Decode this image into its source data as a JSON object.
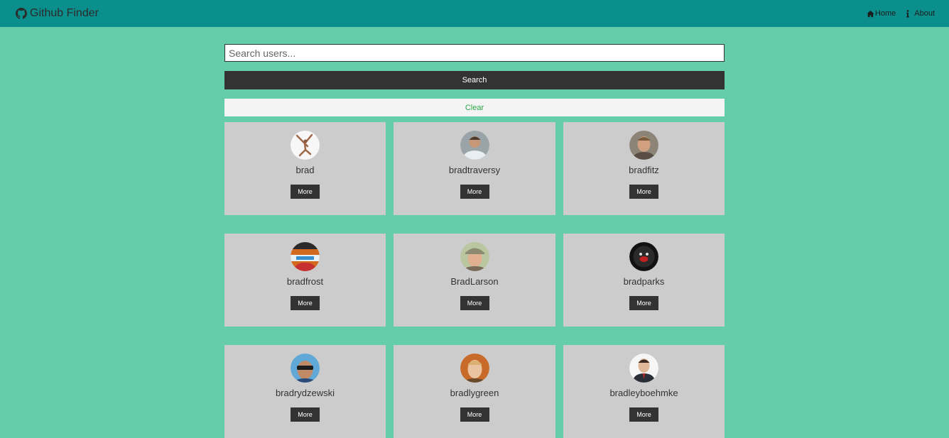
{
  "navbar": {
    "brand_title": "Github Finder",
    "brand_icon": "github-icon",
    "links": [
      {
        "label": "Home",
        "icon": "home-icon"
      },
      {
        "label": "About",
        "icon": "info-icon"
      }
    ]
  },
  "search": {
    "placeholder": "Search users...",
    "value": "",
    "search_label": "Search",
    "clear_label": "Clear"
  },
  "users": [
    {
      "login": "brad",
      "more_label": "More"
    },
    {
      "login": "bradtraversy",
      "more_label": "More"
    },
    {
      "login": "bradfitz",
      "more_label": "More"
    },
    {
      "login": "bradfrost",
      "more_label": "More"
    },
    {
      "login": "BradLarson",
      "more_label": "More"
    },
    {
      "login": "bradparks",
      "more_label": "More"
    },
    {
      "login": "bradrydzewski",
      "more_label": "More"
    },
    {
      "login": "bradlygreen",
      "more_label": "More"
    },
    {
      "login": "bradleyboehmke",
      "more_label": "More"
    }
  ],
  "colors": {
    "page_bg": "#66cdaa",
    "navbar_bg": "#0a8f8c",
    "dark": "#333333",
    "card_bg": "#cccccc",
    "clear_text": "#28a745"
  }
}
